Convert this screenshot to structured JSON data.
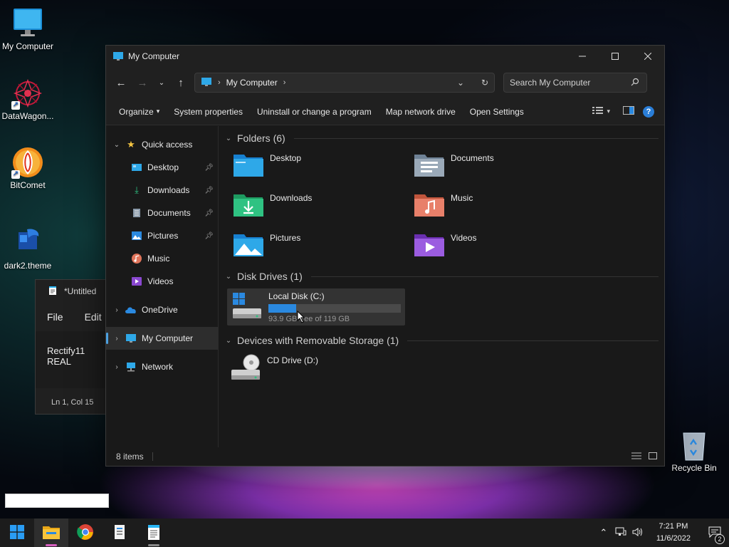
{
  "desktop": {
    "icons": [
      {
        "label": "My Computer",
        "icon": "monitor-icon"
      },
      {
        "label": "DataWagon...",
        "icon": "datawagon-icon"
      },
      {
        "label": "BitComet",
        "icon": "bitcomet-icon"
      },
      {
        "label": "dark2.theme",
        "icon": "theme-icon"
      },
      {
        "label": "Recycle Bin",
        "icon": "recycle-bin-icon"
      }
    ]
  },
  "notepad": {
    "title": "*Untitled",
    "menu": [
      "File",
      "Edit"
    ],
    "body_text": "Rectify11 REAL",
    "status": "Ln 1, Col 15"
  },
  "explorer": {
    "title": "My Computer",
    "address": {
      "crumb": "My Computer"
    },
    "search_placeholder": "Search My Computer",
    "commands": [
      "Organize",
      "System properties",
      "Uninstall or change a program",
      "Map network drive",
      "Open Settings"
    ],
    "nav": {
      "quick_access": "Quick access",
      "quick_items": [
        {
          "label": "Desktop",
          "pinned": true
        },
        {
          "label": "Downloads",
          "pinned": true
        },
        {
          "label": "Documents",
          "pinned": true
        },
        {
          "label": "Pictures",
          "pinned": true
        },
        {
          "label": "Music",
          "pinned": false
        },
        {
          "label": "Videos",
          "pinned": false
        }
      ],
      "onedrive": "OneDrive",
      "my_computer": "My Computer",
      "network": "Network"
    },
    "groups": {
      "folders": "Folders (6)",
      "disks": "Disk Drives (1)",
      "removable": "Devices with Removable Storage (1)"
    },
    "folders": [
      "Desktop",
      "Documents",
      "Downloads",
      "Music",
      "Pictures",
      "Videos"
    ],
    "disk": {
      "name": "Local Disk (C:)",
      "free_text": "93.9 GB free of 119 GB",
      "used_fraction": 0.21
    },
    "cd": {
      "name": "CD Drive (D:)"
    },
    "status": "8 items"
  },
  "taskbar": {
    "time": "7:21 PM",
    "date": "11/6/2022",
    "notifications": "2"
  },
  "colors": {
    "accent": "#2a89e0",
    "taskbar_indicator": "#d65fbf"
  }
}
